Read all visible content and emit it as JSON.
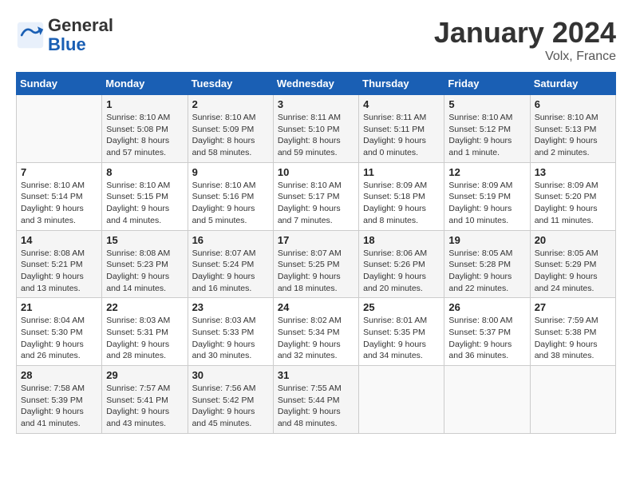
{
  "header": {
    "logo_line1": "General",
    "logo_line2": "Blue",
    "month": "January 2024",
    "location": "Volx, France"
  },
  "weekdays": [
    "Sunday",
    "Monday",
    "Tuesday",
    "Wednesday",
    "Thursday",
    "Friday",
    "Saturday"
  ],
  "weeks": [
    [
      {
        "day": "",
        "info": ""
      },
      {
        "day": "1",
        "info": "Sunrise: 8:10 AM\nSunset: 5:08 PM\nDaylight: 8 hours\nand 57 minutes."
      },
      {
        "day": "2",
        "info": "Sunrise: 8:10 AM\nSunset: 5:09 PM\nDaylight: 8 hours\nand 58 minutes."
      },
      {
        "day": "3",
        "info": "Sunrise: 8:11 AM\nSunset: 5:10 PM\nDaylight: 8 hours\nand 59 minutes."
      },
      {
        "day": "4",
        "info": "Sunrise: 8:11 AM\nSunset: 5:11 PM\nDaylight: 9 hours\nand 0 minutes."
      },
      {
        "day": "5",
        "info": "Sunrise: 8:10 AM\nSunset: 5:12 PM\nDaylight: 9 hours\nand 1 minute."
      },
      {
        "day": "6",
        "info": "Sunrise: 8:10 AM\nSunset: 5:13 PM\nDaylight: 9 hours\nand 2 minutes."
      }
    ],
    [
      {
        "day": "7",
        "info": "Sunrise: 8:10 AM\nSunset: 5:14 PM\nDaylight: 9 hours\nand 3 minutes."
      },
      {
        "day": "8",
        "info": "Sunrise: 8:10 AM\nSunset: 5:15 PM\nDaylight: 9 hours\nand 4 minutes."
      },
      {
        "day": "9",
        "info": "Sunrise: 8:10 AM\nSunset: 5:16 PM\nDaylight: 9 hours\nand 5 minutes."
      },
      {
        "day": "10",
        "info": "Sunrise: 8:10 AM\nSunset: 5:17 PM\nDaylight: 9 hours\nand 7 minutes."
      },
      {
        "day": "11",
        "info": "Sunrise: 8:09 AM\nSunset: 5:18 PM\nDaylight: 9 hours\nand 8 minutes."
      },
      {
        "day": "12",
        "info": "Sunrise: 8:09 AM\nSunset: 5:19 PM\nDaylight: 9 hours\nand 10 minutes."
      },
      {
        "day": "13",
        "info": "Sunrise: 8:09 AM\nSunset: 5:20 PM\nDaylight: 9 hours\nand 11 minutes."
      }
    ],
    [
      {
        "day": "14",
        "info": "Sunrise: 8:08 AM\nSunset: 5:21 PM\nDaylight: 9 hours\nand 13 minutes."
      },
      {
        "day": "15",
        "info": "Sunrise: 8:08 AM\nSunset: 5:23 PM\nDaylight: 9 hours\nand 14 minutes."
      },
      {
        "day": "16",
        "info": "Sunrise: 8:07 AM\nSunset: 5:24 PM\nDaylight: 9 hours\nand 16 minutes."
      },
      {
        "day": "17",
        "info": "Sunrise: 8:07 AM\nSunset: 5:25 PM\nDaylight: 9 hours\nand 18 minutes."
      },
      {
        "day": "18",
        "info": "Sunrise: 8:06 AM\nSunset: 5:26 PM\nDaylight: 9 hours\nand 20 minutes."
      },
      {
        "day": "19",
        "info": "Sunrise: 8:05 AM\nSunset: 5:28 PM\nDaylight: 9 hours\nand 22 minutes."
      },
      {
        "day": "20",
        "info": "Sunrise: 8:05 AM\nSunset: 5:29 PM\nDaylight: 9 hours\nand 24 minutes."
      }
    ],
    [
      {
        "day": "21",
        "info": "Sunrise: 8:04 AM\nSunset: 5:30 PM\nDaylight: 9 hours\nand 26 minutes."
      },
      {
        "day": "22",
        "info": "Sunrise: 8:03 AM\nSunset: 5:31 PM\nDaylight: 9 hours\nand 28 minutes."
      },
      {
        "day": "23",
        "info": "Sunrise: 8:03 AM\nSunset: 5:33 PM\nDaylight: 9 hours\nand 30 minutes."
      },
      {
        "day": "24",
        "info": "Sunrise: 8:02 AM\nSunset: 5:34 PM\nDaylight: 9 hours\nand 32 minutes."
      },
      {
        "day": "25",
        "info": "Sunrise: 8:01 AM\nSunset: 5:35 PM\nDaylight: 9 hours\nand 34 minutes."
      },
      {
        "day": "26",
        "info": "Sunrise: 8:00 AM\nSunset: 5:37 PM\nDaylight: 9 hours\nand 36 minutes."
      },
      {
        "day": "27",
        "info": "Sunrise: 7:59 AM\nSunset: 5:38 PM\nDaylight: 9 hours\nand 38 minutes."
      }
    ],
    [
      {
        "day": "28",
        "info": "Sunrise: 7:58 AM\nSunset: 5:39 PM\nDaylight: 9 hours\nand 41 minutes."
      },
      {
        "day": "29",
        "info": "Sunrise: 7:57 AM\nSunset: 5:41 PM\nDaylight: 9 hours\nand 43 minutes."
      },
      {
        "day": "30",
        "info": "Sunrise: 7:56 AM\nSunset: 5:42 PM\nDaylight: 9 hours\nand 45 minutes."
      },
      {
        "day": "31",
        "info": "Sunrise: 7:55 AM\nSunset: 5:44 PM\nDaylight: 9 hours\nand 48 minutes."
      },
      {
        "day": "",
        "info": ""
      },
      {
        "day": "",
        "info": ""
      },
      {
        "day": "",
        "info": ""
      }
    ]
  ]
}
